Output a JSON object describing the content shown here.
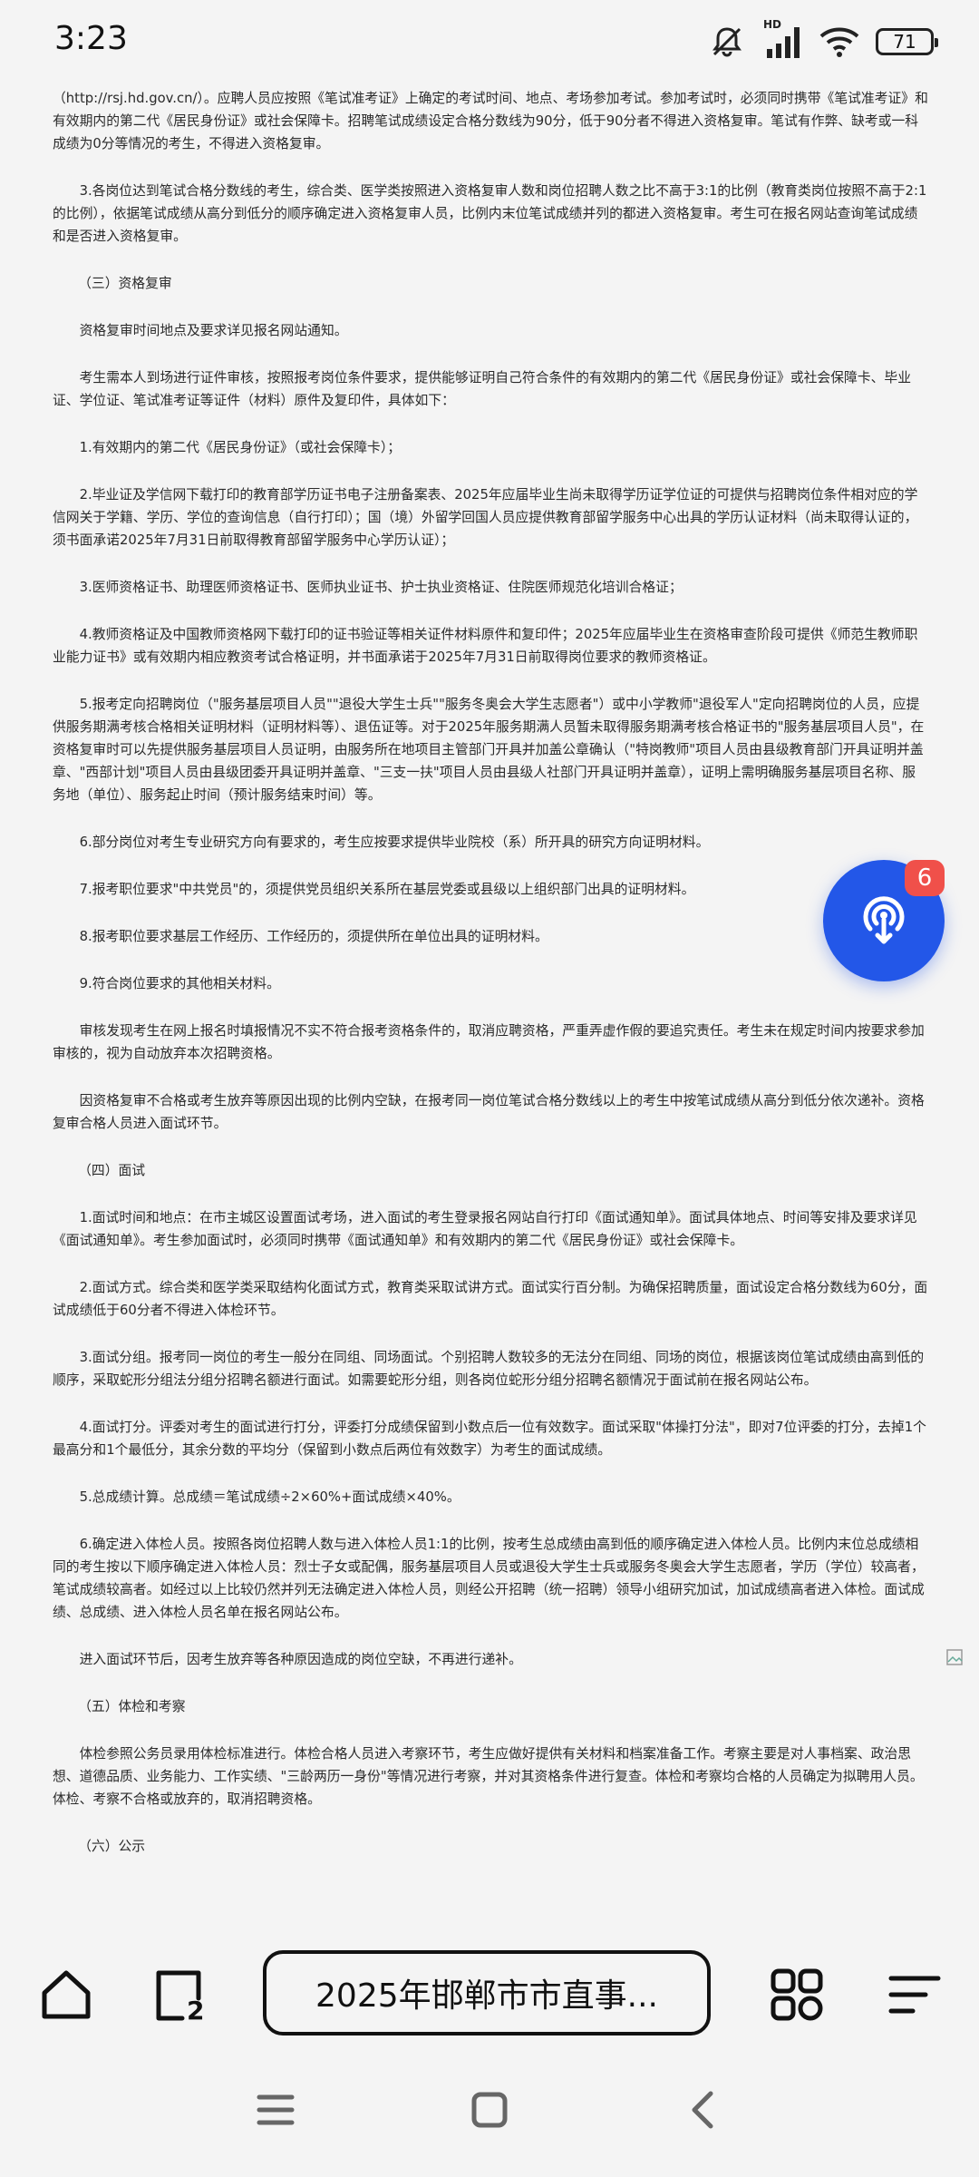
{
  "status_bar": {
    "time": "3:23",
    "network_label": "HD",
    "battery": "71",
    "icons": [
      "mute-icon",
      "signal-icon",
      "wifi-icon",
      "battery-icon"
    ]
  },
  "article": {
    "paragraphs": [
      "（http://rsj.hd.gov.cn/）。应聘人员应按照《笔试准考证》上确定的考试时间、地点、考场参加考试。参加考试时，必须同时携带《笔试准考证》和有效期内的第二代《居民身份证》或社会保障卡。招聘笔试成绩设定合格分数线为90分，低于90分者不得进入资格复审。笔试有作弊、缺考或一科成绩为0分等情况的考生，不得进入资格复审。",
      "3.各岗位达到笔试合格分数线的考生，综合类、医学类按照进入资格复审人数和岗位招聘人数之比不高于3:1的比例（教育类岗位按照不高于2:1的比例），依据笔试成绩从高分到低分的顺序确定进入资格复审人员，比例内末位笔试成绩并列的都进入资格复审。考生可在报名网站查询笔试成绩和是否进入资格复审。",
      "（三）资格复审",
      "资格复审时间地点及要求详见报名网站通知。",
      "考生需本人到场进行证件审核，按照报考岗位条件要求，提供能够证明自己符合条件的有效期内的第二代《居民身份证》或社会保障卡、毕业证、学位证、笔试准考证等证件（材料）原件及复印件，具体如下：",
      "1.有效期内的第二代《居民身份证》（或社会保障卡）；",
      "2.毕业证及学信网下载打印的教育部学历证书电子注册备案表、2025年应届毕业生尚未取得学历证学位证的可提供与招聘岗位条件相对应的学信网关于学籍、学历、学位的查询信息（自行打印）；国（境）外留学回国人员应提供教育部留学服务中心出具的学历认证材料（尚未取得认证的，须书面承诺2025年7月31日前取得教育部留学服务中心学历认证）；",
      "3.医师资格证书、助理医师资格证书、医师执业证书、护士执业资格证、住院医师规范化培训合格证；",
      "4.教师资格证及中国教师资格网下载打印的证书验证等相关证件材料原件和复印件；2025年应届毕业生在资格审查阶段可提供《师范生教师职业能力证书》或有效期内相应教资考试合格证明，并书面承诺于2025年7月31日前取得岗位要求的教师资格证。",
      "5.报考定向招聘岗位（\"服务基层项目人员\"\"退役大学生士兵\"\"服务冬奥会大学生志愿者\"）或中小学教师\"退役军人\"定向招聘岗位的人员，应提供服务期满考核合格相关证明材料（证明材料等）、退伍证等。对于2025年服务期满人员暂未取得服务期满考核合格证书的\"服务基层项目人员\"，在资格复审时可以先提供服务基层项目人员证明，由服务所在地项目主管部门开具并加盖公章确认（\"特岗教师\"项目人员由县级教育部门开具证明并盖章、\"西部计划\"项目人员由县级团委开具证明并盖章、\"三支一扶\"项目人员由县级人社部门开具证明并盖章），证明上需明确服务基层项目名称、服务地（单位）、服务起止时间（预计服务结束时间）等。",
      "6.部分岗位对考生专业研究方向有要求的，考生应按要求提供毕业院校（系）所开具的研究方向证明材料。",
      "7.报考职位要求\"中共党员\"的，须提供党员组织关系所在基层党委或县级以上组织部门出具的证明材料。",
      "8.报考职位要求基层工作经历、工作经历的，须提供所在单位出具的证明材料。",
      "9.符合岗位要求的其他相关材料。",
      "审核发现考生在网上报名时填报情况不实不符合报考资格条件的，取消应聘资格，严重弄虚作假的要追究责任。考生未在规定时间内按要求参加审核的，视为自动放弃本次招聘资格。",
      "因资格复审不合格或考生放弃等原因出现的比例内空缺，在报考同一岗位笔试合格分数线以上的考生中按笔试成绩从高分到低分依次递补。资格复审合格人员进入面试环节。",
      "（四）面试",
      "1.面试时间和地点：在市主城区设置面试考场，进入面试的考生登录报名网站自行打印《面试通知单》。面试具体地点、时间等安排及要求详见《面试通知单》。考生参加面试时，必须同时携带《面试通知单》和有效期内的第二代《居民身份证》或社会保障卡。",
      "2.面试方式。综合类和医学类采取结构化面试方式，教育类采取试讲方式。面试实行百分制。为确保招聘质量，面试设定合格分数线为60分，面试成绩低于60分者不得进入体检环节。",
      "3.面试分组。报考同一岗位的考生一般分在同组、同场面试。个别招聘人数较多的无法分在同组、同场的岗位，根据该岗位笔试成绩由高到低的顺序，采取蛇形分组法分组分招聘名额进行面试。如需要蛇形分组，则各岗位蛇形分组分招聘名额情况于面试前在报名网站公布。",
      "4.面试打分。评委对考生的面试进行打分，评委打分成绩保留到小数点后一位有效数字。面试采取\"体操打分法\"，即对7位评委的打分，去掉1个最高分和1个最低分，其余分数的平均分（保留到小数点后两位有效数字）为考生的面试成绩。",
      "5.总成绩计算。总成绩＝笔试成绩÷2×60%+面试成绩×40%。",
      "6.确定进入体检人员。按照各岗位招聘人数与进入体检人员1:1的比例，按考生总成绩由高到低的顺序确定进入体检人员。比例内末位总成绩相同的考生按以下顺序确定进入体检人员：烈士子女或配偶，服务基层项目人员或退役大学生士兵或服务冬奥会大学生志愿者，学历（学位）较高者，笔试成绩较高者。如经过以上比较仍然并列无法确定进入体检人员，则经公开招聘（统一招聘）领导小组研究加试，加试成绩高者进入体检。面试成绩、总成绩、进入体检人员名单在报名网站公布。",
      "进入面试环节后，因考生放弃等各种原因造成的岗位空缺，不再进行递补。",
      "（五）体检和考察",
      "体检参照公务员录用体检标准进行。体检合格人员进入考察环节，考生应做好提供有关材料和档案准备工作。考察主要是对人事档案、政治思想、道德品质、业务能力、工作实绩、\"三龄两历一身份\"等情况进行考察，并对其资格条件进行复查。体检和考察均合格的人员确定为拟聘用人员。体检、考察不合格或放弃的，取消招聘资格。",
      "（六）公示"
    ]
  },
  "fab": {
    "badge": "6",
    "icon": "broadcast-icon"
  },
  "bottom_bar": {
    "address_title": "2025年邯郸市市直事...",
    "icons": [
      "home-icon",
      "tabs-icon",
      "apps-icon",
      "menu-icon"
    ],
    "tabs_count": "2"
  },
  "system_nav": {
    "icons": [
      "recents-icon",
      "home-square-icon",
      "back-icon"
    ]
  }
}
